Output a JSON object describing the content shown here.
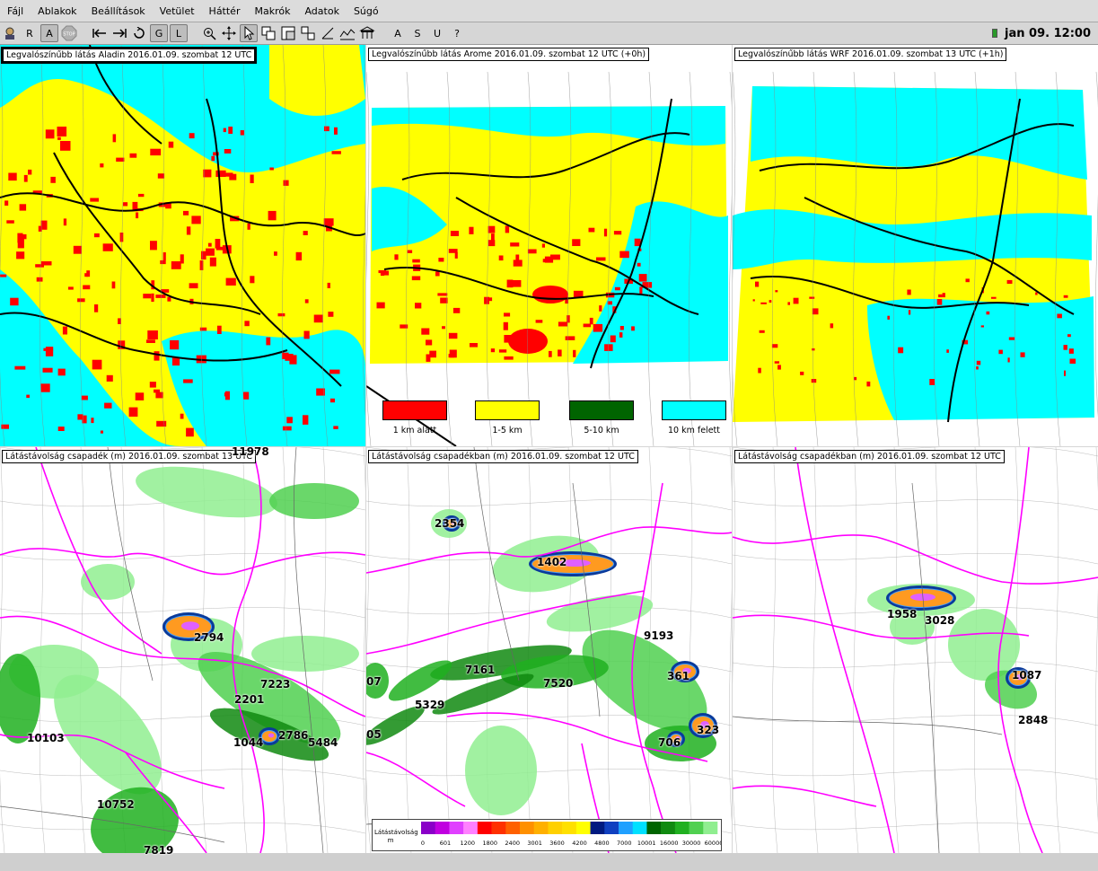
{
  "menu": [
    "Fájl",
    "Ablakok",
    "Beállítások",
    "Vetület",
    "Háttér",
    "Makrók",
    "Adatok",
    "Súgó"
  ],
  "toolbar": {
    "letters": [
      "R",
      "A",
      "G",
      "L",
      "A",
      "S",
      "U",
      "?"
    ],
    "stop_label": "STOP"
  },
  "clock": "jan 09. 12:00",
  "panels": {
    "aladin_vis": "Legvalószínűbb látás Aladin 2016.01.09. szombat 12 UTC",
    "arome_vis": "Legvalószínűbb látás Arome 2016.01.09. szombat 12 UTC (+0h)",
    "wrf_vis": "Legvalószínűbb látás WRF 2016.01.09. szombat 13 UTC (+1h)",
    "aladin_precip": "Látástávolság csapadék (m) 2016.01.09. szombat 13 UTC",
    "arome_precip": "Látástávolság csapadékban (m) 2016.01.09. szombat 12 UTC",
    "wrf_precip": "Látástávolság csapadékban (m) 2016.01.09. szombat 12 UTC"
  },
  "category_legend": [
    {
      "label": "1 km alatt",
      "color": "#ff0000"
    },
    {
      "label": "1-5 km",
      "color": "#ffff00"
    },
    {
      "label": "5-10 km",
      "color": "#006400"
    },
    {
      "label": "10 km felett",
      "color": "#00ffff"
    }
  ],
  "visibility_legend": {
    "title": "Látástávolság",
    "unit": "m",
    "ticks": [
      "0",
      "601",
      "1200",
      "1800",
      "2400",
      "3001",
      "3600",
      "4200",
      "4800",
      "7000",
      "10001",
      "16000",
      "30000",
      "60000"
    ],
    "colors": [
      "#8a00c8",
      "#c000e0",
      "#e040ff",
      "#ff80ff",
      "#ff0000",
      "#ff3000",
      "#ff6000",
      "#ff9000",
      "#ffb000",
      "#ffd000",
      "#ffe000",
      "#ffff00",
      "#001a80",
      "#1040c0",
      "#20a0ff",
      "#00e0ff",
      "#006400",
      "#108a10",
      "#20b020",
      "#50d050",
      "#90ee90"
    ]
  },
  "values": {
    "aladin": [
      "11978",
      "2794",
      "7223",
      "2201",
      "10103",
      "1044",
      "2786",
      "5484",
      "10752",
      "7819"
    ],
    "arome": [
      "2354",
      "1402",
      "9193",
      "7161",
      "7520",
      "361",
      "07",
      "5329",
      "05",
      "706",
      "323"
    ],
    "wrf": [
      "1958",
      "3028",
      "1087",
      "2848"
    ]
  }
}
